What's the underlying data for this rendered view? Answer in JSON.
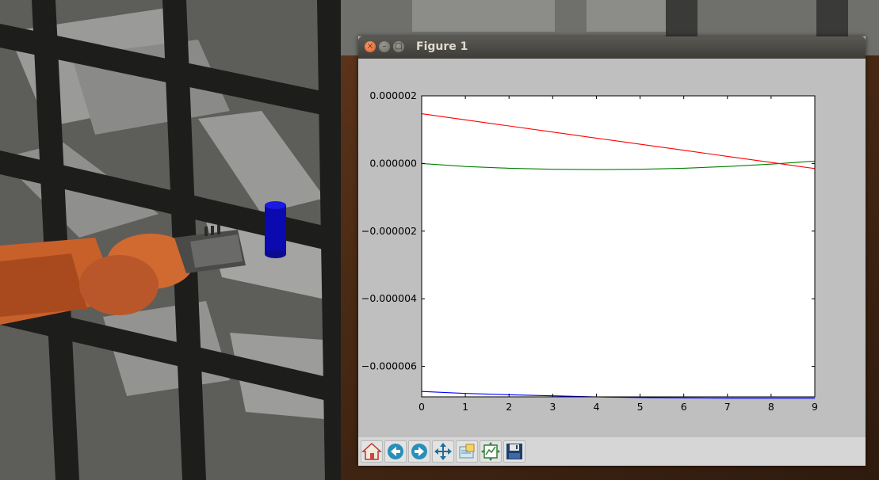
{
  "window": {
    "title": "Figure 1"
  },
  "titlebar": {
    "close_glyph": "×",
    "min_glyph": "–",
    "max_glyph": "□"
  },
  "toolbar": {
    "buttons": [
      {
        "icon": "home-icon"
      },
      {
        "icon": "back-arrow-icon"
      },
      {
        "icon": "forward-arrow-icon"
      },
      {
        "icon": "pan-icon"
      },
      {
        "icon": "zoom-to-rect-icon"
      },
      {
        "icon": "configure-subplots-icon"
      },
      {
        "icon": "save-icon"
      }
    ]
  },
  "chart_data": {
    "type": "line",
    "title": "",
    "xlabel": "",
    "ylabel": "",
    "xlim": [
      0,
      9
    ],
    "ylim": [
      -6.9e-06,
      2e-06
    ],
    "x_ticks": [
      0,
      1,
      2,
      3,
      4,
      5,
      6,
      7,
      8,
      9
    ],
    "x_tick_labels": [
      "0",
      "1",
      "2",
      "3",
      "4",
      "5",
      "6",
      "7",
      "8",
      "9"
    ],
    "y_ticks": [
      2e-06,
      0.0,
      -2e-06,
      -4e-06,
      -6e-06
    ],
    "y_tick_labels": [
      "0.000002",
      "0.000000",
      "−0.000002",
      "−0.000004",
      "−0.000006"
    ],
    "grid": false,
    "x": [
      0,
      1,
      2,
      3,
      4,
      5,
      6,
      7,
      8,
      9
    ],
    "series": [
      {
        "color": "#ff0000",
        "values": [
          1.47e-06,
          1.29e-06,
          1.11e-06,
          9.3e-07,
          7.5e-07,
          5.7e-07,
          3.9e-07,
          2.1e-07,
          3e-08,
          -1.5e-07
        ]
      },
      {
        "color": "#008000",
        "values": [
          0.0,
          -9e-08,
          -1.4e-07,
          -1.7e-07,
          -1.8e-07,
          -1.7e-07,
          -1.4e-07,
          -9e-08,
          -2e-08,
          7e-08
        ]
      },
      {
        "color": "#0000ff",
        "values": [
          -6.74e-06,
          -6.8e-06,
          -6.84e-06,
          -6.87e-06,
          -6.9e-06,
          -6.92e-06,
          -6.93e-06,
          -6.94e-06,
          -6.94e-06,
          -6.94e-06
        ]
      }
    ]
  }
}
